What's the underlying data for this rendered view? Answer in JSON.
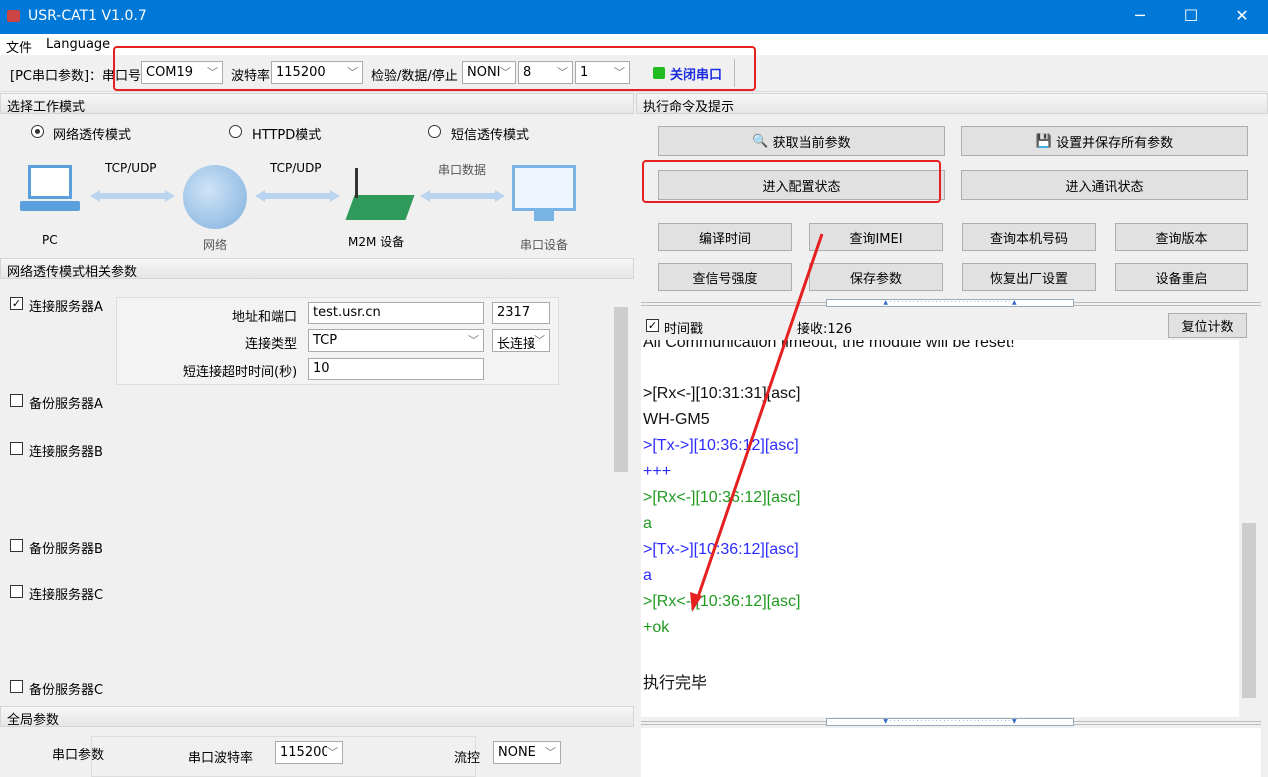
{
  "window": {
    "title": "USR-CAT1 V1.0.7",
    "minimize": "─",
    "maximize": "☐",
    "close": "✕"
  },
  "menu": [
    "文件",
    "Language"
  ],
  "toolbar": {
    "label": "[PC串口参数]：串口号",
    "port": "COM19",
    "baud_label": "波特率",
    "baud": "115200",
    "parity_label": "检验/数据/停止",
    "parity": "NONI",
    "databits": "8",
    "stopbits": "1",
    "close_port": "关闭串口",
    "status_color": "#22bb22"
  },
  "mode": {
    "header": "选择工作模式",
    "options": [
      {
        "label": "网络透传模式",
        "selected": true
      },
      {
        "label": "HTTPD模式",
        "selected": false
      },
      {
        "label": "短信透传模式",
        "selected": false
      }
    ],
    "diagram": {
      "pc": "PC",
      "link1": "TCP/UDP",
      "network": "网络",
      "link2": "TCP/UDP",
      "m2m": "M2M 设备",
      "link3": "串口数据",
      "serial": "串口设备"
    }
  },
  "net_params": {
    "header": "网络透传模式相关参数",
    "serverA": {
      "label": "连接服务器A",
      "checked": true,
      "addr_label": "地址和端口",
      "addr": "test.usr.cn",
      "port": "2317",
      "type_label": "连接类型",
      "type": "TCP",
      "conn_mode": "长连接",
      "timeout_label": "短连接超时时间(秒)",
      "timeout": "10"
    },
    "others": [
      {
        "label": "备份服务器A",
        "checked": false
      },
      {
        "label": "连接服务器B",
        "checked": false
      },
      {
        "label": "备份服务器B",
        "checked": false
      },
      {
        "label": "连接服务器C",
        "checked": false
      },
      {
        "label": "备份服务器C",
        "checked": false
      }
    ]
  },
  "global": {
    "header": "全局参数",
    "serial_label": "串口参数",
    "baud_label": "串口波特率",
    "baud": "115200",
    "flow_label": "流控",
    "flow": "NONE"
  },
  "commands": {
    "header": "执行命令及提示",
    "get_params": "获取当前参数",
    "save_all": "设置并保存所有参数",
    "enter_config": "进入配置状态",
    "enter_comm": "进入通讯状态",
    "row3": [
      "编译时间",
      "查询IMEI",
      "查询本机号码",
      "查询版本"
    ],
    "row4": [
      "查信号强度",
      "保存参数",
      "恢复出厂设置",
      "设备重启"
    ]
  },
  "log": {
    "timestamp_label": "时间戳",
    "timestamp_checked": true,
    "recv": "接收:126",
    "reset": "复位计数",
    "lines": [
      {
        "text": "All Communication timeout, the module will be reset!",
        "c": "blk"
      },
      {
        "text": ">[Rx<-][10:31:31][asc]",
        "c": "blk"
      },
      {
        "text": "WH-GM5",
        "c": "blk"
      },
      {
        "text": ">[Tx->][10:36:12][asc]",
        "c": "blu"
      },
      {
        "text": "+++",
        "c": "blu"
      },
      {
        "text": ">[Rx<-][10:36:12][asc]",
        "c": "grn"
      },
      {
        "text": "a",
        "c": "grn"
      },
      {
        "text": ">[Tx->][10:36:12][asc]",
        "c": "blu"
      },
      {
        "text": "a",
        "c": "blu"
      },
      {
        "text": ">[Rx<-][10:36:12][asc]",
        "c": "grn"
      },
      {
        "text": "+ok",
        "c": "grn"
      },
      {
        "text": "执行完毕",
        "c": "blk"
      }
    ]
  }
}
